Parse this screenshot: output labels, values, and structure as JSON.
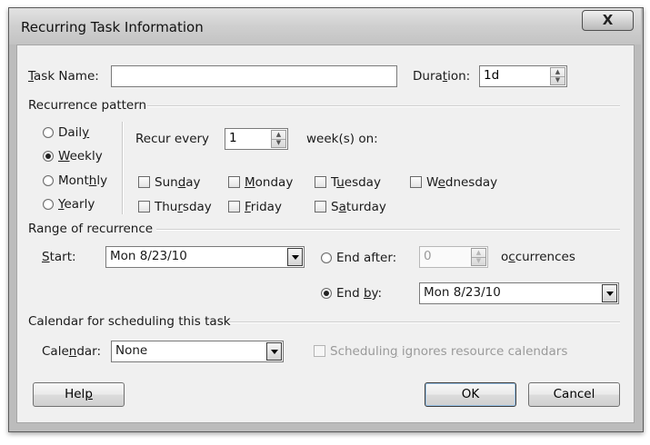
{
  "window": {
    "title": "Recurring Task Information",
    "close_glyph": "X"
  },
  "task_name": {
    "label_u": "T",
    "label_rest": "ask Name:",
    "value": ""
  },
  "duration": {
    "label_pre": "Dura",
    "label_u": "t",
    "label_post": "ion:",
    "value": "1d"
  },
  "recurrence_pattern": {
    "header": "Recurrence pattern",
    "options": [
      {
        "pre": "Dail",
        "u": "y",
        "post": "",
        "selected": false
      },
      {
        "pre": "",
        "u": "W",
        "post": "eekly",
        "selected": true
      },
      {
        "pre": "Mont",
        "u": "h",
        "post": "ly",
        "selected": false
      },
      {
        "pre": "",
        "u": "Y",
        "post": "early",
        "selected": false
      }
    ],
    "recur_every_label": "Recur every",
    "recur_every_value": "1",
    "weeks_on_label": "week(s) on:",
    "days": [
      {
        "pre": "Sun",
        "u": "d",
        "post": "ay",
        "checked": false
      },
      {
        "pre": "",
        "u": "M",
        "post": "onday",
        "checked": false
      },
      {
        "pre": "T",
        "u": "u",
        "post": "esday",
        "checked": false
      },
      {
        "pre": "W",
        "u": "e",
        "post": "dnesday",
        "checked": false
      },
      {
        "pre": "Thu",
        "u": "r",
        "post": "sday",
        "checked": false
      },
      {
        "pre": "",
        "u": "F",
        "post": "riday",
        "checked": false
      },
      {
        "pre": "S",
        "u": "a",
        "post": "turday",
        "checked": false
      }
    ]
  },
  "range_of_recurrence": {
    "header": "Range of recurrence",
    "start_label_u": "S",
    "start_label_rest": "tart:",
    "start_value": "Mon 8/23/10",
    "end_after_label": "End after:",
    "end_after_value": "0",
    "occurrences_pre": "o",
    "occurrences_u": "c",
    "occurrences_post": "currences",
    "end_after_selected": false,
    "end_by_pre": "End ",
    "end_by_u": "b",
    "end_by_post": "y:",
    "end_by_selected": true,
    "end_by_value": "Mon 8/23/10"
  },
  "calendar": {
    "header": "Calendar for scheduling this task",
    "label_pre": "Cale",
    "label_u": "n",
    "label_post": "dar:",
    "value": "None",
    "ignore_pre": "Schedulin",
    "ignore_u": "g",
    "ignore_post": " ignores resource calendars",
    "ignore_checked": false
  },
  "buttons": {
    "help_pre": "Hel",
    "help_u": "p",
    "ok": "OK",
    "cancel": "Cancel"
  }
}
